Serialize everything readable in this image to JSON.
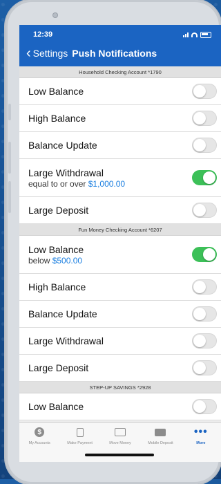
{
  "status": {
    "time": "12:39"
  },
  "nav": {
    "back_label": "Settings",
    "title": "Push Notifications"
  },
  "sections": [
    {
      "header": "Household Checking Account *1790",
      "rows": [
        {
          "label": "Low Balance",
          "sub": "",
          "amount": "",
          "on": false
        },
        {
          "label": "High Balance",
          "sub": "",
          "amount": "",
          "on": false
        },
        {
          "label": "Balance Update",
          "sub": "",
          "amount": "",
          "on": false
        },
        {
          "label": "Large Withdrawal",
          "sub": "equal to or over ",
          "amount": "$1,000.00",
          "on": true
        },
        {
          "label": "Large Deposit",
          "sub": "",
          "amount": "",
          "on": false
        }
      ]
    },
    {
      "header": "Fun Money Checking Account *6207",
      "rows": [
        {
          "label": "Low Balance",
          "sub": "below ",
          "amount": "$500.00",
          "on": true
        },
        {
          "label": "High Balance",
          "sub": "",
          "amount": "",
          "on": false
        },
        {
          "label": "Balance Update",
          "sub": "",
          "amount": "",
          "on": false
        },
        {
          "label": "Large Withdrawal",
          "sub": "",
          "amount": "",
          "on": false
        },
        {
          "label": "Large Deposit",
          "sub": "",
          "amount": "",
          "on": false
        }
      ]
    },
    {
      "header": "STEP-UP SAVINGS *2928",
      "rows": [
        {
          "label": "Low Balance",
          "sub": "",
          "amount": "",
          "on": false
        }
      ]
    }
  ],
  "tabs": [
    {
      "label": "My Accounts",
      "icon": "dollar-icon",
      "active": false
    },
    {
      "label": "Make Payment",
      "icon": "payment-icon",
      "active": false
    },
    {
      "label": "Move Money",
      "icon": "transfer-icon",
      "active": false
    },
    {
      "label": "Mobile Deposit",
      "icon": "deposit-icon",
      "active": false
    },
    {
      "label": "More",
      "icon": "more-icon",
      "active": true
    }
  ],
  "colors": {
    "brand": "#1b64c2",
    "toggle_on": "#3cc058",
    "amount": "#1b7fe0"
  }
}
